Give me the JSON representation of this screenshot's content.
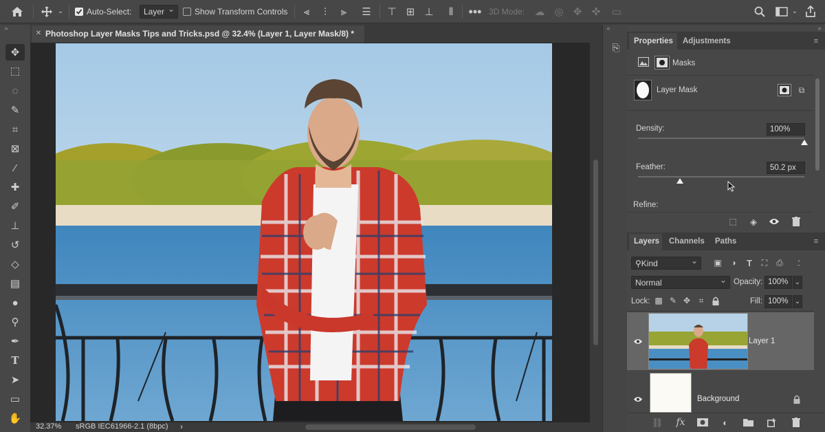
{
  "options_bar": {
    "auto_select_label": "Auto-Select:",
    "auto_select_value": "Layer",
    "show_transform_label": "Show Transform Controls",
    "mode_3d_label": "3D Mode:"
  },
  "document": {
    "tab_title": "Photoshop Layer Masks Tips and Tricks.psd @ 32.4% (Layer 1, Layer Mask/8) *",
    "close_glyph": "✕"
  },
  "status_bar": {
    "zoom": "32.37%",
    "profile": "sRGB IEC61966-2.1 (8bpc)",
    "arrow": "›"
  },
  "properties": {
    "tabs": [
      "Properties",
      "Adjustments"
    ],
    "masks_label": "Masks",
    "mask_type": "Layer Mask",
    "density_label": "Density:",
    "density_value": "100%",
    "density_level": 1.0,
    "feather_label": "Feather:",
    "feather_value": "50.2 px",
    "feather_level": 0.25,
    "refine_label": "Refine:"
  },
  "layers_panel": {
    "tabs": [
      "Layers",
      "Channels",
      "Paths"
    ],
    "filter_kind": "Kind",
    "blend_mode": "Normal",
    "opacity_label": "Opacity:",
    "opacity_value": "100%",
    "lock_label": "Lock:",
    "fill_label": "Fill:",
    "fill_value": "100%",
    "layers": [
      {
        "name": "Layer 1",
        "selected": true
      },
      {
        "name": "Background",
        "selected": false
      }
    ],
    "footer_fx": "fx"
  },
  "colors": {
    "accent": "#1473e6",
    "panel_bg": "#474747",
    "canvas_bg": "#282828"
  }
}
